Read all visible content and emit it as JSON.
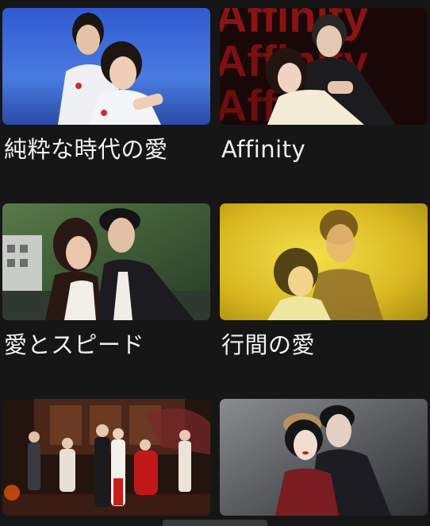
{
  "dramas": [
    {
      "title": "純粋な時代の愛",
      "poster": "couple-in-school-uniforms-poster"
    },
    {
      "title": "Affinity",
      "poster": "affinity-drama-poster",
      "poster_text": "Affinity"
    },
    {
      "title": "愛とスピード",
      "poster": "couple-in-mountains-poster"
    },
    {
      "title": "行間の愛",
      "poster": "golden-light-couple-poster"
    },
    {
      "title": "",
      "poster": "historical-ensemble-poster"
    },
    {
      "title": "",
      "poster": "historical-couple-poster"
    }
  ]
}
